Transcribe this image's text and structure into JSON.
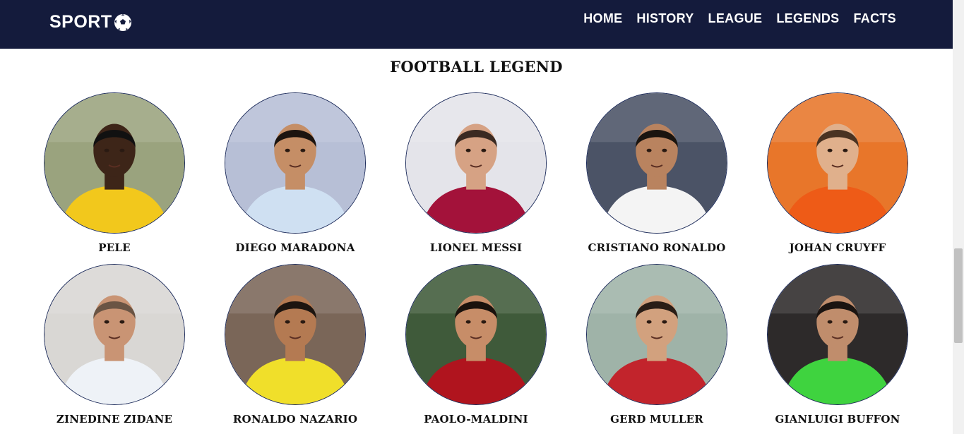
{
  "header": {
    "logo_text": "SPORT",
    "logo_icon": "soccer-ball-icon",
    "nav": [
      "HOME",
      "HISTORY",
      "LEAGUE",
      "LEGENDS",
      "FACTS"
    ]
  },
  "section": {
    "title": "FOOTBALL LEGEND"
  },
  "legends": [
    {
      "name": "PELE",
      "bg": "#9aa37e",
      "shirt": "#f2c81c",
      "skin": "#3d2518",
      "hair": "#111111"
    },
    {
      "name": "DIEGO MARADONA",
      "bg": "#b7bfd6",
      "shirt": "#cfe0f2",
      "skin": "#c58e66",
      "hair": "#1c140f"
    },
    {
      "name": "LIONEL MESSI",
      "bg": "#e4e4ea",
      "shirt": "#a3123a",
      "skin": "#d6a284",
      "hair": "#3b2a22"
    },
    {
      "name": "CRISTIANO RONALDO",
      "bg": "#4b5366",
      "shirt": "#f4f4f4",
      "skin": "#b9835f",
      "hair": "#1a140f"
    },
    {
      "name": "JOHAN CRUYFF",
      "bg": "#e8762a",
      "shirt": "#ee5b17",
      "skin": "#e0b08c",
      "hair": "#4a3322"
    },
    {
      "name": "ZINEDINE ZIDANE",
      "bg": "#d9d7d4",
      "shirt": "#eef2f7",
      "skin": "#c99474",
      "hair": "#6a5444"
    },
    {
      "name": "RONALDO NAZARIO",
      "bg": "#7a6658",
      "shirt": "#f0df2a",
      "skin": "#b47a52",
      "hair": "#1d1510"
    },
    {
      "name": "PAOLO-MALDINI",
      "bg": "#3f5a3a",
      "shirt": "#b0141e",
      "skin": "#c78d68",
      "hair": "#1a120d"
    },
    {
      "name": "GERD MULLER",
      "bg": "#9fb3a8",
      "shirt": "#c2242c",
      "skin": "#d2a17e",
      "hair": "#2a1d16"
    },
    {
      "name": "GIANLUIGI BUFFON",
      "bg": "#2d2a2a",
      "shirt": "#3fd33f",
      "skin": "#c08d6c",
      "hair": "#1b1411"
    }
  ]
}
